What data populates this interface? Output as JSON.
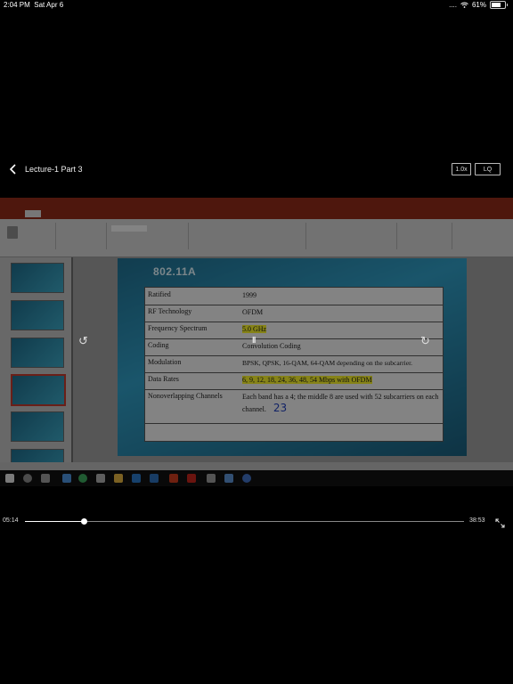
{
  "status_bar": {
    "time": "2:04 PM",
    "date": "Sat Apr 6",
    "signal": "....",
    "battery": "61%"
  },
  "header": {
    "title": "Lecture-1 Part 3",
    "speed": "1.0x",
    "quality": "LQ"
  },
  "slide": {
    "heading": "802.11A",
    "rows": [
      {
        "label": "Ratified",
        "value": "1999"
      },
      {
        "label": "RF Technology",
        "value": "OFDM"
      },
      {
        "label": "Frequency Spectrum",
        "value": "5.0 GHz"
      },
      {
        "label": "Coding",
        "value": "Convolution Coding"
      },
      {
        "label": "Modulation",
        "value": "BPSK, QPSK, 16-QAM, 64-QAM depending on the subcarrier."
      },
      {
        "label": "Data Rates",
        "value": "6, 9, 12, 18, 24, 36, 48, 54 Mbps with OFDM"
      },
      {
        "label": "Nonoverlapping Channels",
        "value": "Each band has a 4; the middle 8 are used with 52 subcarriers on each channel.",
        "ink": "23"
      }
    ]
  },
  "player": {
    "current_time": "05:14",
    "total_time": "38:53",
    "progress": 0.135,
    "pause_glyph": "II",
    "rewind_glyph": "↺",
    "forward_glyph": "↻"
  },
  "colors": {
    "ppt_accent": "#8e2a17",
    "slide_bg": "#2f9bc2",
    "highlight": "#f3ef2a",
    "ink": "#1e3cb8"
  }
}
